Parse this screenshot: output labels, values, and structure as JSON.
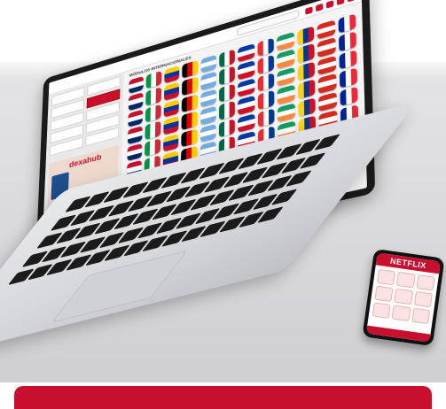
{
  "brand": {
    "logo_text": "dexahub",
    "accent": "#c8102e"
  },
  "laptop": {
    "section_title": "MÓDULOS INTERNACIONALES",
    "sidebar_buttons": [
      "",
      "",
      "",
      "",
      "",
      "",
      "",
      "",
      "",
      ""
    ],
    "flags_count": 72
  },
  "phone": {
    "header_title": "NETFLIX"
  },
  "icons": [
    "search-icon",
    "user-icon",
    "bell-icon",
    "gear-icon",
    "home-icon"
  ]
}
